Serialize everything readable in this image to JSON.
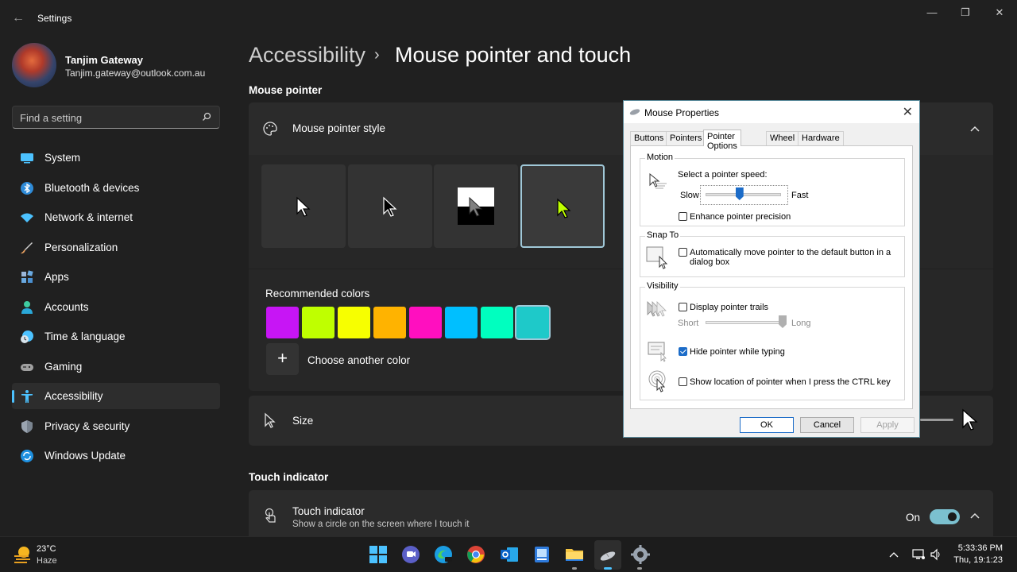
{
  "window": {
    "app_title": "Settings",
    "controls": {
      "minimize": "—",
      "restore": "❐",
      "close": "✕"
    }
  },
  "user": {
    "name": "Tanjim Gateway",
    "email": "Tanjim.gateway@outlook.com.au"
  },
  "search": {
    "placeholder": "Find a setting"
  },
  "sidebar": {
    "items": [
      {
        "label": "System",
        "icon": "monitor-icon",
        "color": "#4cc2ff"
      },
      {
        "label": "Bluetooth & devices",
        "icon": "bluetooth-icon",
        "color": "#2e8bd8"
      },
      {
        "label": "Network & internet",
        "icon": "wifi-icon",
        "color": "#4cc2ff"
      },
      {
        "label": "Personalization",
        "icon": "brush-icon",
        "color": "#e8a060"
      },
      {
        "label": "Apps",
        "icon": "apps-icon",
        "color": "#6aa9e0"
      },
      {
        "label": "Accounts",
        "icon": "person-icon",
        "color": "#3fcca0"
      },
      {
        "label": "Time & language",
        "icon": "globe-clock-icon",
        "color": "#4cc2ff"
      },
      {
        "label": "Gaming",
        "icon": "gamepad-icon",
        "color": "#a0a0a0"
      },
      {
        "label": "Accessibility",
        "icon": "accessibility-icon",
        "color": "#4cc2ff"
      },
      {
        "label": "Privacy & security",
        "icon": "shield-icon",
        "color": "#9aa4b0"
      },
      {
        "label": "Windows Update",
        "icon": "sync-icon",
        "color": "#1e90e0"
      }
    ],
    "active_index": 8
  },
  "breadcrumb": {
    "parent": "Accessibility",
    "separator": "›",
    "current": "Mouse pointer and touch"
  },
  "mouse_pointer": {
    "heading": "Mouse pointer",
    "style_label": "Mouse pointer style",
    "style_options": [
      "white",
      "black",
      "inverted",
      "custom"
    ],
    "selected_style": "custom",
    "recommended_label": "Recommended colors",
    "colors": [
      "#c715f5",
      "#bfff00",
      "#f7ff00",
      "#ffb300",
      "#ff0fbf",
      "#00bfff",
      "#00ffbf",
      "#1ec9c9"
    ],
    "selected_color_index": 7,
    "choose_color_label": "Choose another color",
    "size_label": "Size"
  },
  "touch": {
    "heading": "Touch indicator",
    "title": "Touch indicator",
    "description": "Show a circle on the screen where I touch it",
    "state": "On"
  },
  "dialog": {
    "title": "Mouse Properties",
    "tabs": [
      "Buttons",
      "Pointers",
      "Pointer Options",
      "Wheel",
      "Hardware"
    ],
    "active_tab": "Pointer Options",
    "motion": {
      "group": "Motion",
      "select_speed": "Select a pointer speed:",
      "slow": "Slow",
      "fast": "Fast",
      "speed_fraction": 0.45,
      "enhance_precision": "Enhance pointer precision",
      "enhance_checked": false
    },
    "snap_to": {
      "group": "Snap To",
      "label_line1": "Automatically move pointer to the default button in a",
      "label_line2": "dialog box",
      "checked": false
    },
    "visibility": {
      "group": "Visibility",
      "trails": "Display pointer trails",
      "trails_checked": false,
      "short": "Short",
      "long": "Long",
      "trail_fraction": 1.0,
      "hide_typing": "Hide pointer while typing",
      "hide_checked": true,
      "show_location": "Show location of pointer when I press the CTRL key",
      "show_checked": false
    },
    "buttons": {
      "ok": "OK",
      "cancel": "Cancel",
      "apply": "Apply"
    }
  },
  "taskbar": {
    "weather_temp": "23°C",
    "weather_desc": "Haze",
    "apps": [
      "start-icon",
      "teams-icon",
      "edge-dev-icon",
      "chrome-icon",
      "outlook-icon",
      "todo-icon",
      "file-explorer-icon",
      "mouse-app-icon",
      "settings-icon"
    ],
    "time": "5:33:36 PM",
    "date": "Thu, 19:1:23"
  }
}
